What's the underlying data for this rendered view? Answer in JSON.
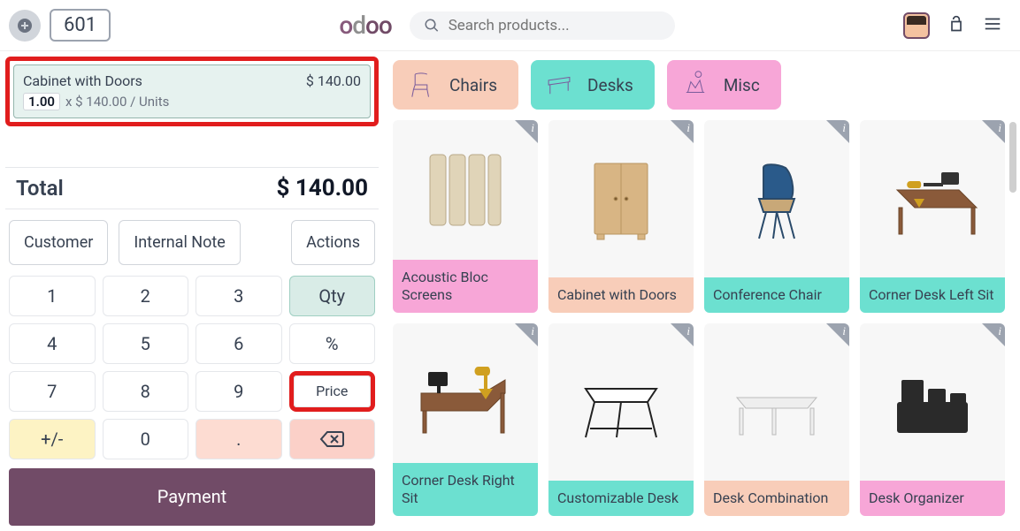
{
  "topbar": {
    "order_number": "601",
    "search_placeholder": "Search products..."
  },
  "order_line": {
    "name": "Cabinet with Doors",
    "line_total": "$ 140.00",
    "qty": "1.00",
    "price_units": "x $ 140.00 / Units"
  },
  "totals": {
    "label": "Total",
    "value": "$ 140.00"
  },
  "actions": {
    "customer": "Customer",
    "internal_note": "Internal Note",
    "actions": "Actions"
  },
  "keypad": {
    "k1": "1",
    "k2": "2",
    "k3": "3",
    "k4": "4",
    "k5": "5",
    "k6": "6",
    "k7": "7",
    "k8": "8",
    "k9": "9",
    "k0": "0",
    "pm": "+/-",
    "dot": ".",
    "qty": "Qty",
    "pct": "%",
    "price": "Price"
  },
  "payment": {
    "label": "Payment"
  },
  "categories": {
    "chairs": "Chairs",
    "desks": "Desks",
    "misc": "Misc"
  },
  "products": [
    {
      "name": "Acoustic Bloc Screens",
      "tint": "pink"
    },
    {
      "name": "Cabinet with Doors",
      "tint": "peach"
    },
    {
      "name": "Conference Chair",
      "tint": "teal"
    },
    {
      "name": "Corner Desk Left Sit",
      "tint": "teal"
    },
    {
      "name": "Corner Desk Right Sit",
      "tint": "teal"
    },
    {
      "name": "Customizable Desk",
      "tint": "teal"
    },
    {
      "name": "Desk Combination",
      "tint": "peach"
    },
    {
      "name": "Desk Organizer",
      "tint": "pink"
    }
  ]
}
